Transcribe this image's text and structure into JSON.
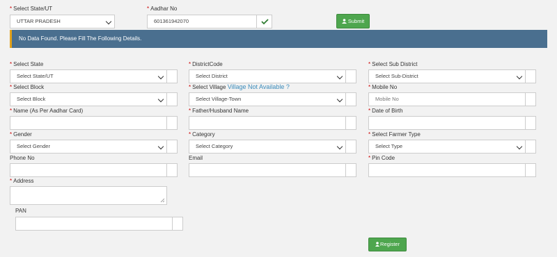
{
  "top": {
    "state_label": "Select State/UT",
    "state_value": "UTTAR PRADESH",
    "aadhar_label": "Aadhar No",
    "aadhar_value": "601361942070",
    "submit_label": "Submit"
  },
  "banner": {
    "message": "No Data Found. Please Fill The Following Details."
  },
  "form": {
    "state": {
      "label": "Select State",
      "placeholder": "Select State/UT"
    },
    "district": {
      "label": "DistrictCode",
      "placeholder": "Select District"
    },
    "subdistrict": {
      "label": "Select Sub District",
      "placeholder": "Select Sub-District"
    },
    "block": {
      "label": "Select Block",
      "placeholder": "Select Block"
    },
    "village": {
      "label": "Select Village",
      "link": "Village Not Available ?",
      "placeholder": "Select Village-Town"
    },
    "mobile": {
      "label": "Mobile No",
      "placeholder": "Mobile No"
    },
    "name": {
      "label": "Name (As Per Aadhar Card)"
    },
    "father": {
      "label": "Father/Husband Name"
    },
    "dob": {
      "label": "Date of Birth"
    },
    "gender": {
      "label": "Gender",
      "placeholder": "Select Gender"
    },
    "category": {
      "label": "Category",
      "placeholder": "Select Category"
    },
    "farmer_type": {
      "label": "Select Farmer Type",
      "placeholder": "Select Type"
    },
    "phone": {
      "label": "Phone No"
    },
    "email": {
      "label": "Email"
    },
    "pincode": {
      "label": "Pin Code"
    },
    "address": {
      "label": "Address"
    },
    "pan": {
      "label": "PAN"
    }
  },
  "register_label": "Register",
  "required_marker": "*",
  "colors": {
    "button_green": "#4ea64e",
    "banner_blue": "#4a6f8f",
    "banner_accent": "#e3a21a",
    "link": "#3a8bbb"
  }
}
